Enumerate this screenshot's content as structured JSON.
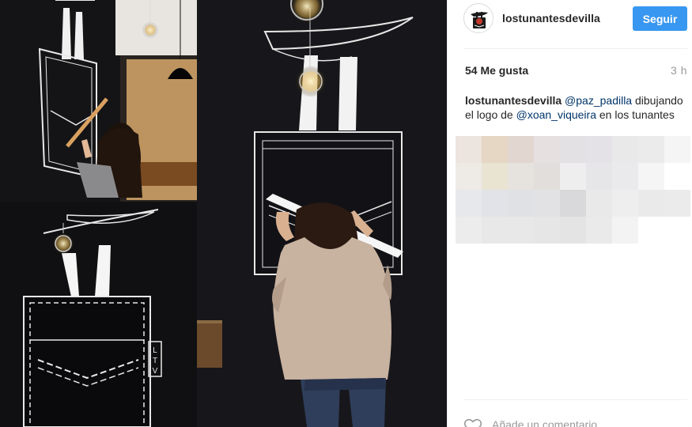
{
  "post": {
    "username": "lostunantesdevilla",
    "follow_label": "Seguir",
    "likes": "54 Me gusta",
    "time": "3 h",
    "caption": {
      "user": "lostunantesdevilla",
      "mention_1": "@paz_padilla",
      "text_1": " dibujando el logo de ",
      "mention_2": "@xoan_viqueira",
      "text_2": " en los tunantes"
    },
    "comment_placeholder": "Añade un comentario...",
    "more_glyph": "···"
  },
  "icons": {
    "avatar": "logo-avatar",
    "like": "heart-icon",
    "more": "more-options-icon"
  },
  "photo": {
    "sign_letters": [
      "L",
      "T",
      "V"
    ]
  },
  "colors": {
    "follow_button": "#3897f0",
    "mention": "#003569",
    "muted": "#999999",
    "text": "#262626",
    "photo_background": "#0f0f11"
  }
}
